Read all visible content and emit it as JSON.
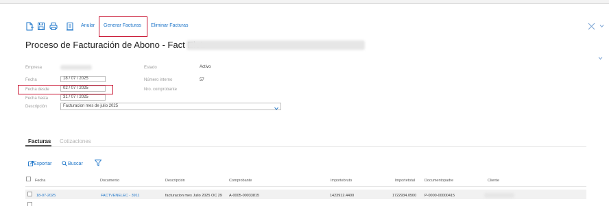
{
  "toolbar": {
    "anular_label": "Anular",
    "generar_label": "Generar Facturas",
    "eliminar_label": "Eliminar Facturas"
  },
  "page": {
    "title": "Proceso de Facturación de Abono - Fact Eletr"
  },
  "form": {
    "empresa_label": "Empresa",
    "fecha_label": "Fecha",
    "fecha_value": "18 / 07 / 2025",
    "fecha_desde_label": "Fecha desde",
    "fecha_desde_value": "02 / 07 / 2025",
    "fecha_hasta_label": "Fecha hasta",
    "fecha_hasta_value": "31 / 07 / 2025",
    "descripcion_label": "Descripción",
    "descripcion_value": "Facturacion mes de julio 2025",
    "estado_label": "Estado",
    "estado_value": "Activo",
    "numero_interno_label": "Número interno",
    "numero_interno_value": "57",
    "nro_comprobante_label": "Nro. comprobante"
  },
  "tabs": [
    {
      "label": "Facturas",
      "active": true
    },
    {
      "label": "Cotizaciones",
      "active": false
    }
  ],
  "actions": {
    "exportar_label": "Exportar",
    "buscar_label": "Buscar"
  },
  "table": {
    "columns": [
      "Fecha",
      "Documento",
      "Descripción",
      "Comprobante",
      "Importebruto",
      "Importetotal",
      "Documentopadre",
      "Cliente"
    ],
    "rows": [
      {
        "fecha": "18-07-2025",
        "documento": "FACTVENELEC - 3911",
        "descripcion": "facturacion mes Julio 2025 OC 29",
        "comprobante": "A-0005-00033815",
        "importebruto": "1423912.4400",
        "importetotal": "1722934.0500",
        "documentopadre": "P-0000-00000415"
      }
    ]
  },
  "colors": {
    "link": "#1a73c8",
    "highlight": "#c8102e"
  }
}
